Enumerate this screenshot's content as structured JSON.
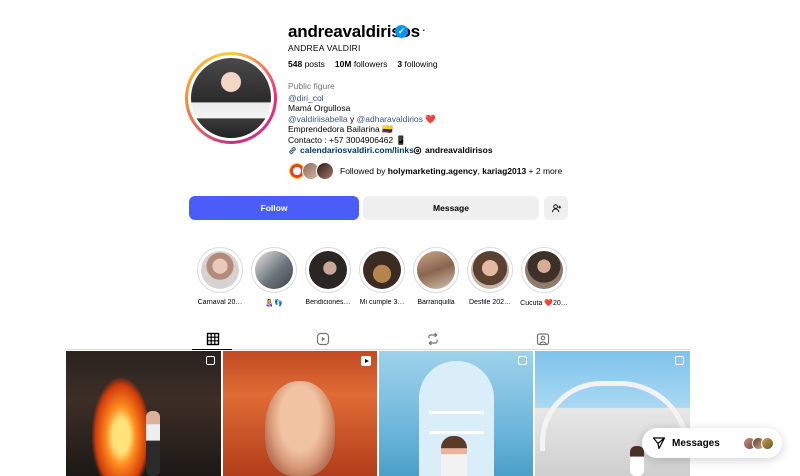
{
  "profile": {
    "username": "andreavaldirisos",
    "full_name": "ANDREA VALDIRI",
    "more_icon": "···",
    "verified_icon": "✓",
    "stats": {
      "posts_count": "548",
      "posts_label": "posts",
      "followers_count": "10M",
      "followers_label": "followers",
      "following_count": "3",
      "following_label": "following"
    },
    "category": "Public figure",
    "bio": {
      "line1": "@diri_col",
      "line2": "Mamá Orgullosa",
      "line3_mention1": "@valdiriisabella",
      "line3_connector": " y ",
      "line3_mention2": "@adharavaldirios",
      "line3_heart": " ❤️",
      "line4": "Emprendedora Bailarina 🇨🇴",
      "line5": "Contacto : +57 3004906462 📱"
    },
    "external_link": "calendariosvaldiri.com/links",
    "threads_handle": "andreavaldirisos",
    "followed_by": {
      "prefix": "Followed by ",
      "user1": "holymarketing.agency",
      "separator": ", ",
      "user2": "kariag2013",
      "suffix": " + 2 more"
    }
  },
  "actions": {
    "follow_label": "Follow",
    "message_label": "Message",
    "add_icon": "+👤"
  },
  "highlights": [
    {
      "label": "Carnaval 20…"
    },
    {
      "label": "👩‍🍼👣"
    },
    {
      "label": "Bendiciones…"
    },
    {
      "label": "Mi cumple 3…"
    },
    {
      "label": "Barranquilla"
    },
    {
      "label": "Desfile 202…"
    },
    {
      "label": "Cucuta ❤️20…"
    }
  ],
  "tabs": [
    "posts-grid",
    "reels",
    "reposts",
    "tagged"
  ],
  "messages": {
    "label": "Messages"
  },
  "colors": {
    "follow_button": "#4a5df9",
    "link": "#00376b",
    "verified": "#0095f6"
  }
}
